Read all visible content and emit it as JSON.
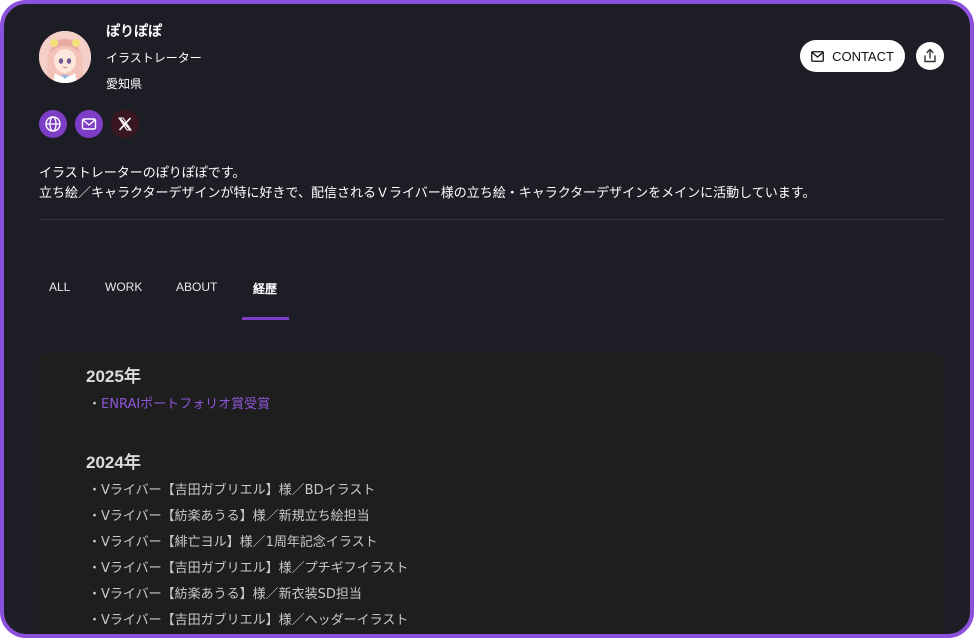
{
  "profile": {
    "name": "ぽりぽぽ",
    "role": "イラストレーター",
    "location": "愛知県",
    "avatar_icon": "avatar-illustration"
  },
  "social": [
    {
      "icon": "globe-icon"
    },
    {
      "icon": "mail-icon"
    },
    {
      "icon": "x-logo-icon"
    }
  ],
  "header": {
    "contact_label": "CONTACT",
    "share_icon": "share-upload-icon"
  },
  "bio": {
    "line1": "イラストレーターのぽりぽぽです。",
    "line2": "立ち絵／キャラクターデザインが特に好きで、配信されるＶライバー様の立ち絵・キャラクターデザインをメインに活動しています。"
  },
  "tabs": [
    {
      "label": "ALL"
    },
    {
      "label": "WORK"
    },
    {
      "label": "ABOUT"
    },
    {
      "label": "経歴",
      "active": true
    }
  ],
  "history": [
    {
      "year": "2025年",
      "items": [
        {
          "bullet": "・",
          "text": "ENRAIポートフォリオ賞受賞",
          "link": true
        }
      ]
    },
    {
      "year": "2024年",
      "items": [
        {
          "bullet": "・",
          "text": "Vライバー【吉田ガブリエル】様／BDイラスト"
        },
        {
          "bullet": "・",
          "text": "Vライバー【紡楽あうる】様／新規立ち絵担当"
        },
        {
          "bullet": "・",
          "text": "Vライバー【緋亡ヨル】様／1周年記念イラスト"
        },
        {
          "bullet": "・",
          "text": "Vライバー【吉田ガブリエル】様／プチギフイラスト"
        },
        {
          "bullet": "・",
          "text": "Vライバー【紡楽あうる】様／新衣装SD担当"
        },
        {
          "bullet": "・",
          "text": "Vライバー【吉田ガブリエル】様／ヘッダーイラスト"
        }
      ]
    }
  ],
  "colors": {
    "accent": "#7d3ec7",
    "frame": "#8b50dc",
    "background": "#1d1e25",
    "link": "#8e55d6"
  }
}
